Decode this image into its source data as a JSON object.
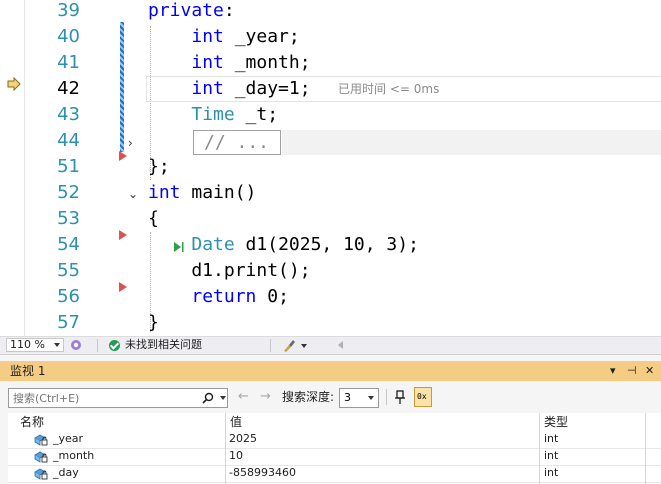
{
  "editor": {
    "lines": [
      {
        "num": "39",
        "tokens": [
          {
            "t": "private",
            "c": "kw"
          },
          {
            "t": ":",
            "c": ""
          }
        ]
      },
      {
        "num": "40",
        "tokens": [
          {
            "t": "    ",
            "c": ""
          },
          {
            "t": "int",
            "c": "kw"
          },
          {
            "t": " _year;",
            "c": ""
          }
        ]
      },
      {
        "num": "41",
        "tokens": [
          {
            "t": "    ",
            "c": ""
          },
          {
            "t": "int",
            "c": "kw"
          },
          {
            "t": " _month;",
            "c": ""
          }
        ]
      },
      {
        "num": "42",
        "tokens": [
          {
            "t": "    ",
            "c": ""
          },
          {
            "t": "int",
            "c": "kw"
          },
          {
            "t": " _day=1;",
            "c": ""
          }
        ]
      },
      {
        "num": "43",
        "tokens": [
          {
            "t": "    ",
            "c": ""
          },
          {
            "t": "Time",
            "c": "ty"
          },
          {
            "t": " _t;",
            "c": ""
          }
        ]
      },
      {
        "num": "44",
        "tokens": []
      },
      {
        "num": "51",
        "tokens": [
          {
            "t": "};",
            "c": ""
          }
        ]
      },
      {
        "num": "52",
        "tokens": [
          {
            "t": "int",
            "c": "kw"
          },
          {
            "t": " main()",
            "c": ""
          }
        ]
      },
      {
        "num": "53",
        "tokens": [
          {
            "t": "{",
            "c": ""
          }
        ]
      },
      {
        "num": "54",
        "tokens": [
          {
            "t": "    ",
            "c": ""
          },
          {
            "t": "Date",
            "c": "ty"
          },
          {
            "t": " d1(2025, 10, 3);",
            "c": ""
          }
        ]
      },
      {
        "num": "55",
        "tokens": [
          {
            "t": "    d1.print();",
            "c": ""
          }
        ]
      },
      {
        "num": "56",
        "tokens": [
          {
            "t": "    ",
            "c": ""
          },
          {
            "t": "return",
            "c": "kw"
          },
          {
            "t": " 0;",
            "c": ""
          }
        ]
      },
      {
        "num": "57",
        "tokens": [
          {
            "t": "}",
            "c": ""
          }
        ]
      }
    ],
    "current_line": "42",
    "perf_tip": "已用时间 <= 0ms",
    "collapsed_text": "// ..."
  },
  "status_bar": {
    "zoom": "110 %",
    "issues_text": "未找到相关问题"
  },
  "watch": {
    "title": "监视 1",
    "title_buttons": [
      "▾",
      "⊣",
      "✕"
    ],
    "search_placeholder": "搜索(Ctrl+E)",
    "depth_label": "搜索深度:",
    "depth_value": "3",
    "hex_label": "0x",
    "columns": [
      "名称",
      "值",
      "类型"
    ],
    "rows": [
      {
        "name": "_year",
        "value": "2025",
        "type": "int"
      },
      {
        "name": "_month",
        "value": "10",
        "type": "int"
      },
      {
        "name": "_day",
        "value": "-858993460",
        "type": "int"
      }
    ]
  }
}
